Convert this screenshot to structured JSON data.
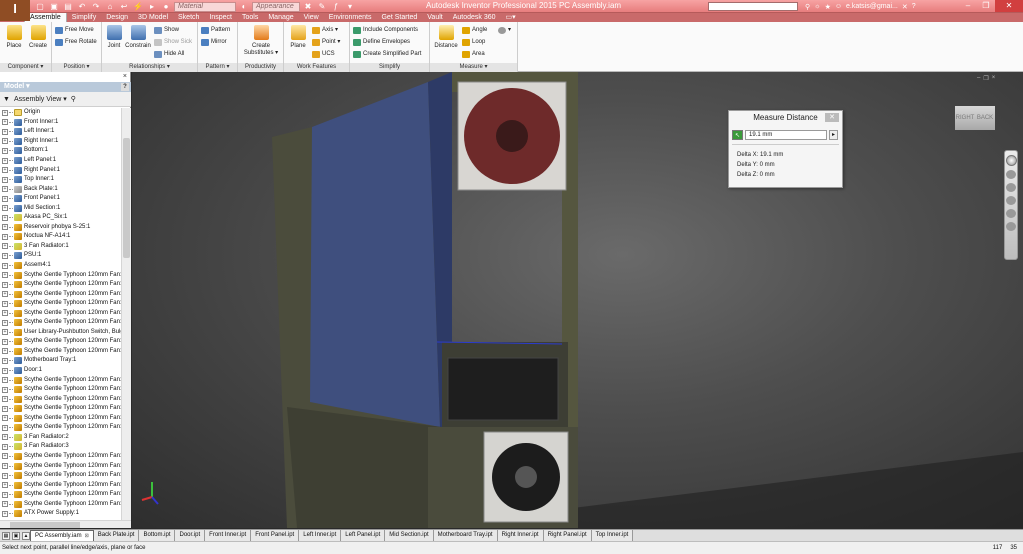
{
  "app": {
    "logo_letter": "I",
    "title": "Autodesk Inventor Professional 2015   PC Assembly.iam",
    "material_combo": "Material",
    "appearance_combo": "Appearance",
    "user": "e.katsis@gmai...",
    "help": "?"
  },
  "tabs": [
    "Assemble",
    "Simplify",
    "Design",
    "3D Model",
    "Sketch",
    "Inspect",
    "Tools",
    "Manage",
    "View",
    "Environments",
    "Get Started",
    "Vault",
    "Autodesk 360"
  ],
  "ribbon": {
    "component": {
      "title": "Component ▾",
      "place": "Place",
      "create": "Create"
    },
    "position": {
      "title": "Position ▾",
      "free_move": "Free Move",
      "free_rotate": "Free Rotate"
    },
    "relationships": {
      "title": "Relationships ▾",
      "joint": "Joint",
      "constrain": "Constrain",
      "show": "Show",
      "show_sick": "Show Sick",
      "hide_all": "Hide All"
    },
    "pattern": {
      "title": "Pattern ▾",
      "pattern": "Pattern",
      "mirror": "Mirror"
    },
    "productivity": {
      "title": "Productivity",
      "create_substitutes": "Create Substitutes ▾"
    },
    "work_features": {
      "title": "Work Features",
      "plane": "Plane",
      "axis": "Axis ▾",
      "point": "Point ▾",
      "ucs": "UCS"
    },
    "simplify": {
      "title": "Simplify",
      "include_components": "Include Components",
      "define_envelopes": "Define Envelopes",
      "create_simplified_part": "Create Simplified Part"
    },
    "measure": {
      "title": "Measure ▾",
      "distance": "Distance",
      "angle": "Angle",
      "loop": "Loop",
      "area": "Area"
    }
  },
  "browser": {
    "header": "Model ▾",
    "view": "Assembly View ▾",
    "items": [
      {
        "label": "Origin",
        "icon": "folder"
      },
      {
        "label": "Front Inner:1",
        "icon": "part"
      },
      {
        "label": "Left Inner:1",
        "icon": "part"
      },
      {
        "label": "Right Inner:1",
        "icon": "part"
      },
      {
        "label": "Bottom:1",
        "icon": "part"
      },
      {
        "label": "Left Panel:1",
        "icon": "part"
      },
      {
        "label": "Right Panel:1",
        "icon": "part"
      },
      {
        "label": "Top Inner:1",
        "icon": "part"
      },
      {
        "label": "Back Plate:1",
        "icon": "grey"
      },
      {
        "label": "Front Panel:1",
        "icon": "part"
      },
      {
        "label": "Mid Section:1",
        "icon": "part"
      },
      {
        "label": "Akasa PC_Six:1",
        "icon": "grn"
      },
      {
        "label": "Reservoir phobya S-25:1",
        "icon": "asm"
      },
      {
        "label": "Noctua NF-A14:1",
        "icon": "asm"
      },
      {
        "label": "3 Fan Radiator:1",
        "icon": "grn"
      },
      {
        "label": "PSU:1",
        "icon": "part"
      },
      {
        "label": "Assem4:1",
        "icon": "asm"
      },
      {
        "label": "Scythe Gentle Typhoon 120mm Fan:1",
        "icon": "asm"
      },
      {
        "label": "Scythe Gentle Typhoon 120mm Fan:2",
        "icon": "asm"
      },
      {
        "label": "Scythe Gentle Typhoon 120mm Fan:3",
        "icon": "asm"
      },
      {
        "label": "Scythe Gentle Typhoon 120mm Fan:4",
        "icon": "asm"
      },
      {
        "label": "Scythe Gentle Typhoon 120mm Fan:5",
        "icon": "asm"
      },
      {
        "label": "Scythe Gentle Typhoon 120mm Fan:6",
        "icon": "asm"
      },
      {
        "label": "User Library-Pushbutton Switch, Bulg",
        "icon": "asm"
      },
      {
        "label": "Scythe Gentle Typhoon 120mm Fan:7",
        "icon": "asm"
      },
      {
        "label": "Scythe Gentle Typhoon 120mm Fan:8",
        "icon": "asm"
      },
      {
        "label": "Motherboard Tray:1",
        "icon": "part"
      },
      {
        "label": "Door:1",
        "icon": "part"
      },
      {
        "label": "Scythe Gentle Typhoon 120mm Fan:9",
        "icon": "asm"
      },
      {
        "label": "Scythe Gentle Typhoon 120mm Fan:1",
        "icon": "asm"
      },
      {
        "label": "Scythe Gentle Typhoon 120mm Fan:1",
        "icon": "asm"
      },
      {
        "label": "Scythe Gentle Typhoon 120mm Fan:1",
        "icon": "asm"
      },
      {
        "label": "Scythe Gentle Typhoon 120mm Fan:1",
        "icon": "asm"
      },
      {
        "label": "Scythe Gentle Typhoon 120mm Fan:1",
        "icon": "asm"
      },
      {
        "label": "3 Fan Radiator:2",
        "icon": "grn"
      },
      {
        "label": "3 Fan Radiator:3",
        "icon": "grn"
      },
      {
        "label": "Scythe Gentle Typhoon 120mm Fan:1",
        "icon": "asm"
      },
      {
        "label": "Scythe Gentle Typhoon 120mm Fan:1",
        "icon": "asm"
      },
      {
        "label": "Scythe Gentle Typhoon 120mm Fan:1",
        "icon": "asm"
      },
      {
        "label": "Scythe Gentle Typhoon 120mm Fan:1",
        "icon": "asm"
      },
      {
        "label": "Scythe Gentle Typhoon 120mm Fan:1",
        "icon": "asm"
      },
      {
        "label": "Scythe Gentle Typhoon 120mm Fan:2",
        "icon": "asm"
      },
      {
        "label": "ATX Power Supply:1",
        "icon": "asm"
      }
    ]
  },
  "measure_distance": {
    "title": "Measure Distance",
    "value": "19.1 mm",
    "delta_x": "Delta X: 19.1 mm",
    "delta_y": "Delta Y: 0 mm",
    "delta_z": "Delta Z: 0 mm"
  },
  "viewcube": {
    "left": "RIGHT",
    "back": "BACK"
  },
  "doc_tabs": [
    "PC Assembly.iam",
    "Back Plate.ipt",
    "Bottom.ipt",
    "Door.ipt",
    "Front Inner.ipt",
    "Front Panel.ipt",
    "Left Inner.ipt",
    "Left Panel.ipt",
    "Mid Section.ipt",
    "Motherboard Tray.ipt",
    "Right Inner.ipt",
    "Right Panel.ipt",
    "Top Inner.ipt"
  ],
  "status": {
    "text": "Select next point, parallel line/edge/axis, plane or face",
    "coord1": "117",
    "coord2": "35"
  }
}
